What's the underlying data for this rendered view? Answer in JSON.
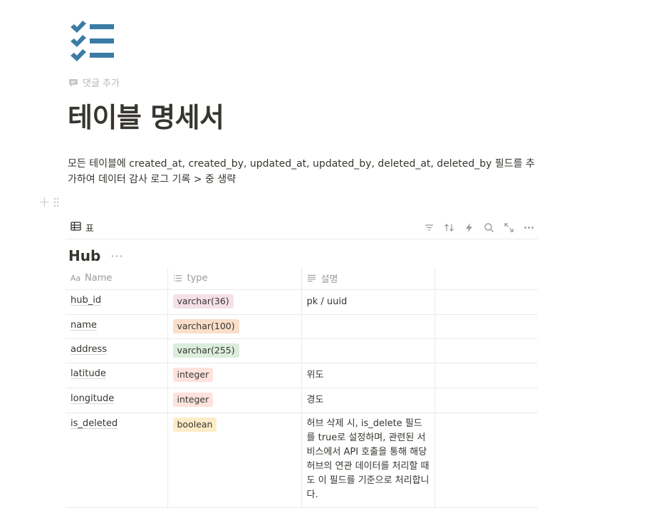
{
  "page": {
    "icon": "checklist-icon",
    "add_comment_label": "댓글 추가",
    "title": "테이블 명세서",
    "description": "모든 테이블에 created_at, created_by, updated_at, updated_by, deleted_at, deleted_by 필드를 추가하여 데이터 감사 로그 기록 > 중 생략"
  },
  "view": {
    "tab_label": "표",
    "tools": [
      "filter-icon",
      "sort-icon",
      "lightning-icon",
      "search-icon",
      "expand-icon",
      "more-icon"
    ]
  },
  "database": {
    "title": "Hub",
    "more_label": "···",
    "columns": [
      {
        "label": "Name",
        "icon_text": "Aa"
      },
      {
        "label": "type",
        "icon": "list-icon"
      },
      {
        "label": "설명",
        "icon": "text-icon"
      },
      {
        "label": ""
      }
    ],
    "rows": [
      {
        "name": "hub_id",
        "type": "varchar(36)",
        "type_color": "#f5e0e9",
        "desc": "pk / uuid"
      },
      {
        "name": "name",
        "type": "varchar(100)",
        "type_color": "#fadec9",
        "desc": ""
      },
      {
        "name": "address",
        "type": "varchar(255)",
        "type_color": "#dbeddb",
        "desc": ""
      },
      {
        "name": "latitude",
        "type": "integer",
        "type_color": "#ffe2dd",
        "desc": "위도"
      },
      {
        "name": "longitude",
        "type": "integer",
        "type_color": "#ffe2dd",
        "desc": "경도"
      },
      {
        "name": "is_deleted",
        "type": "boolean",
        "type_color": "#fdecc8",
        "desc": " 허브 삭제 시, is_delete 필드를 true로 설정하며, 관련된 서비스에서 API 호출을 통해 해당 허브의 연관 데이터를 처리할 때도 이 필드를 기준으로 처리합니다."
      }
    ]
  }
}
